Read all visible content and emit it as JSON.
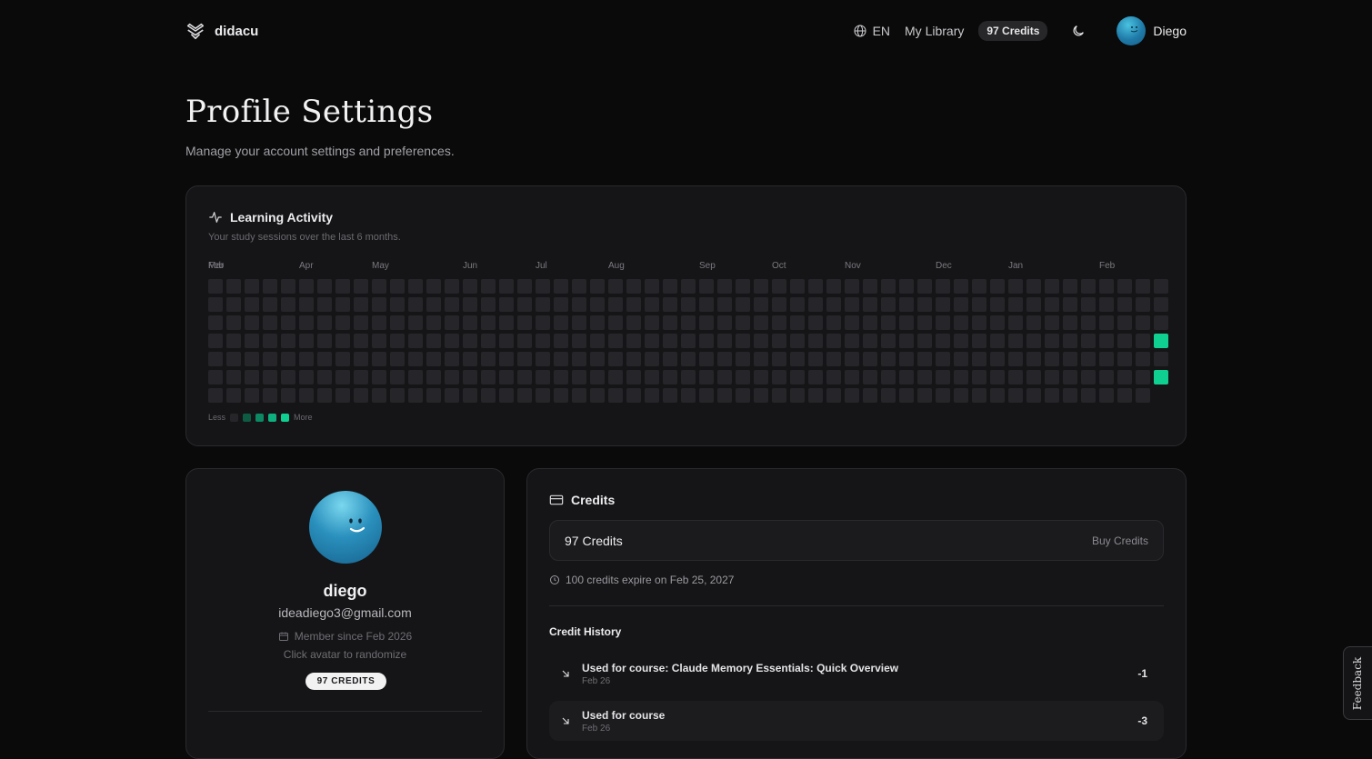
{
  "header": {
    "brand": "didacu",
    "language": "EN",
    "library_link": "My Library",
    "credits_pill": "97 Credits",
    "user_name": "Diego"
  },
  "page": {
    "title": "Profile Settings",
    "subtitle": "Manage your account settings and preferences."
  },
  "activity": {
    "title": "Learning Activity",
    "subtitle": "Your study sessions over the last 6 months.",
    "months": [
      "Feb",
      "Mar",
      "Apr",
      "May",
      "Jun",
      "Jul",
      "Aug",
      "Sep",
      "Oct",
      "Nov",
      "Dec",
      "Jan",
      "Feb"
    ],
    "legend_less": "Less",
    "legend_more": "More",
    "legend_colors": [
      "#26262a",
      "#0e5b43",
      "#0c8863",
      "#0fb07f",
      "#10d091"
    ],
    "active_color": "#10d091",
    "active_days": [
      {
        "week": 52,
        "weekday": 3
      },
      {
        "week": 52,
        "weekday": 5
      }
    ]
  },
  "profile": {
    "name": "diego",
    "email": "ideadiego3@gmail.com",
    "member_since": "Member since Feb 2026",
    "hint": "Click avatar to randomize",
    "badge": "97 CREDITS"
  },
  "credits": {
    "title": "Credits",
    "amount": "97 Credits",
    "buy": "Buy Credits",
    "expire_note": "100 credits expire on Feb 25, 2027",
    "history_title": "Credit History",
    "history": [
      {
        "label": "Used for course: Claude Memory Essentials: Quick Overview",
        "date": "Feb 26",
        "amount": "-1"
      },
      {
        "label": "Used for course",
        "date": "Feb 26",
        "amount": "-3"
      }
    ]
  },
  "feedback_label": "Feedback",
  "colors": {
    "background": "#0a0a0b",
    "card": "#151517",
    "accent_green": "#10d091",
    "avatar_blue": "#1f7aa8"
  }
}
